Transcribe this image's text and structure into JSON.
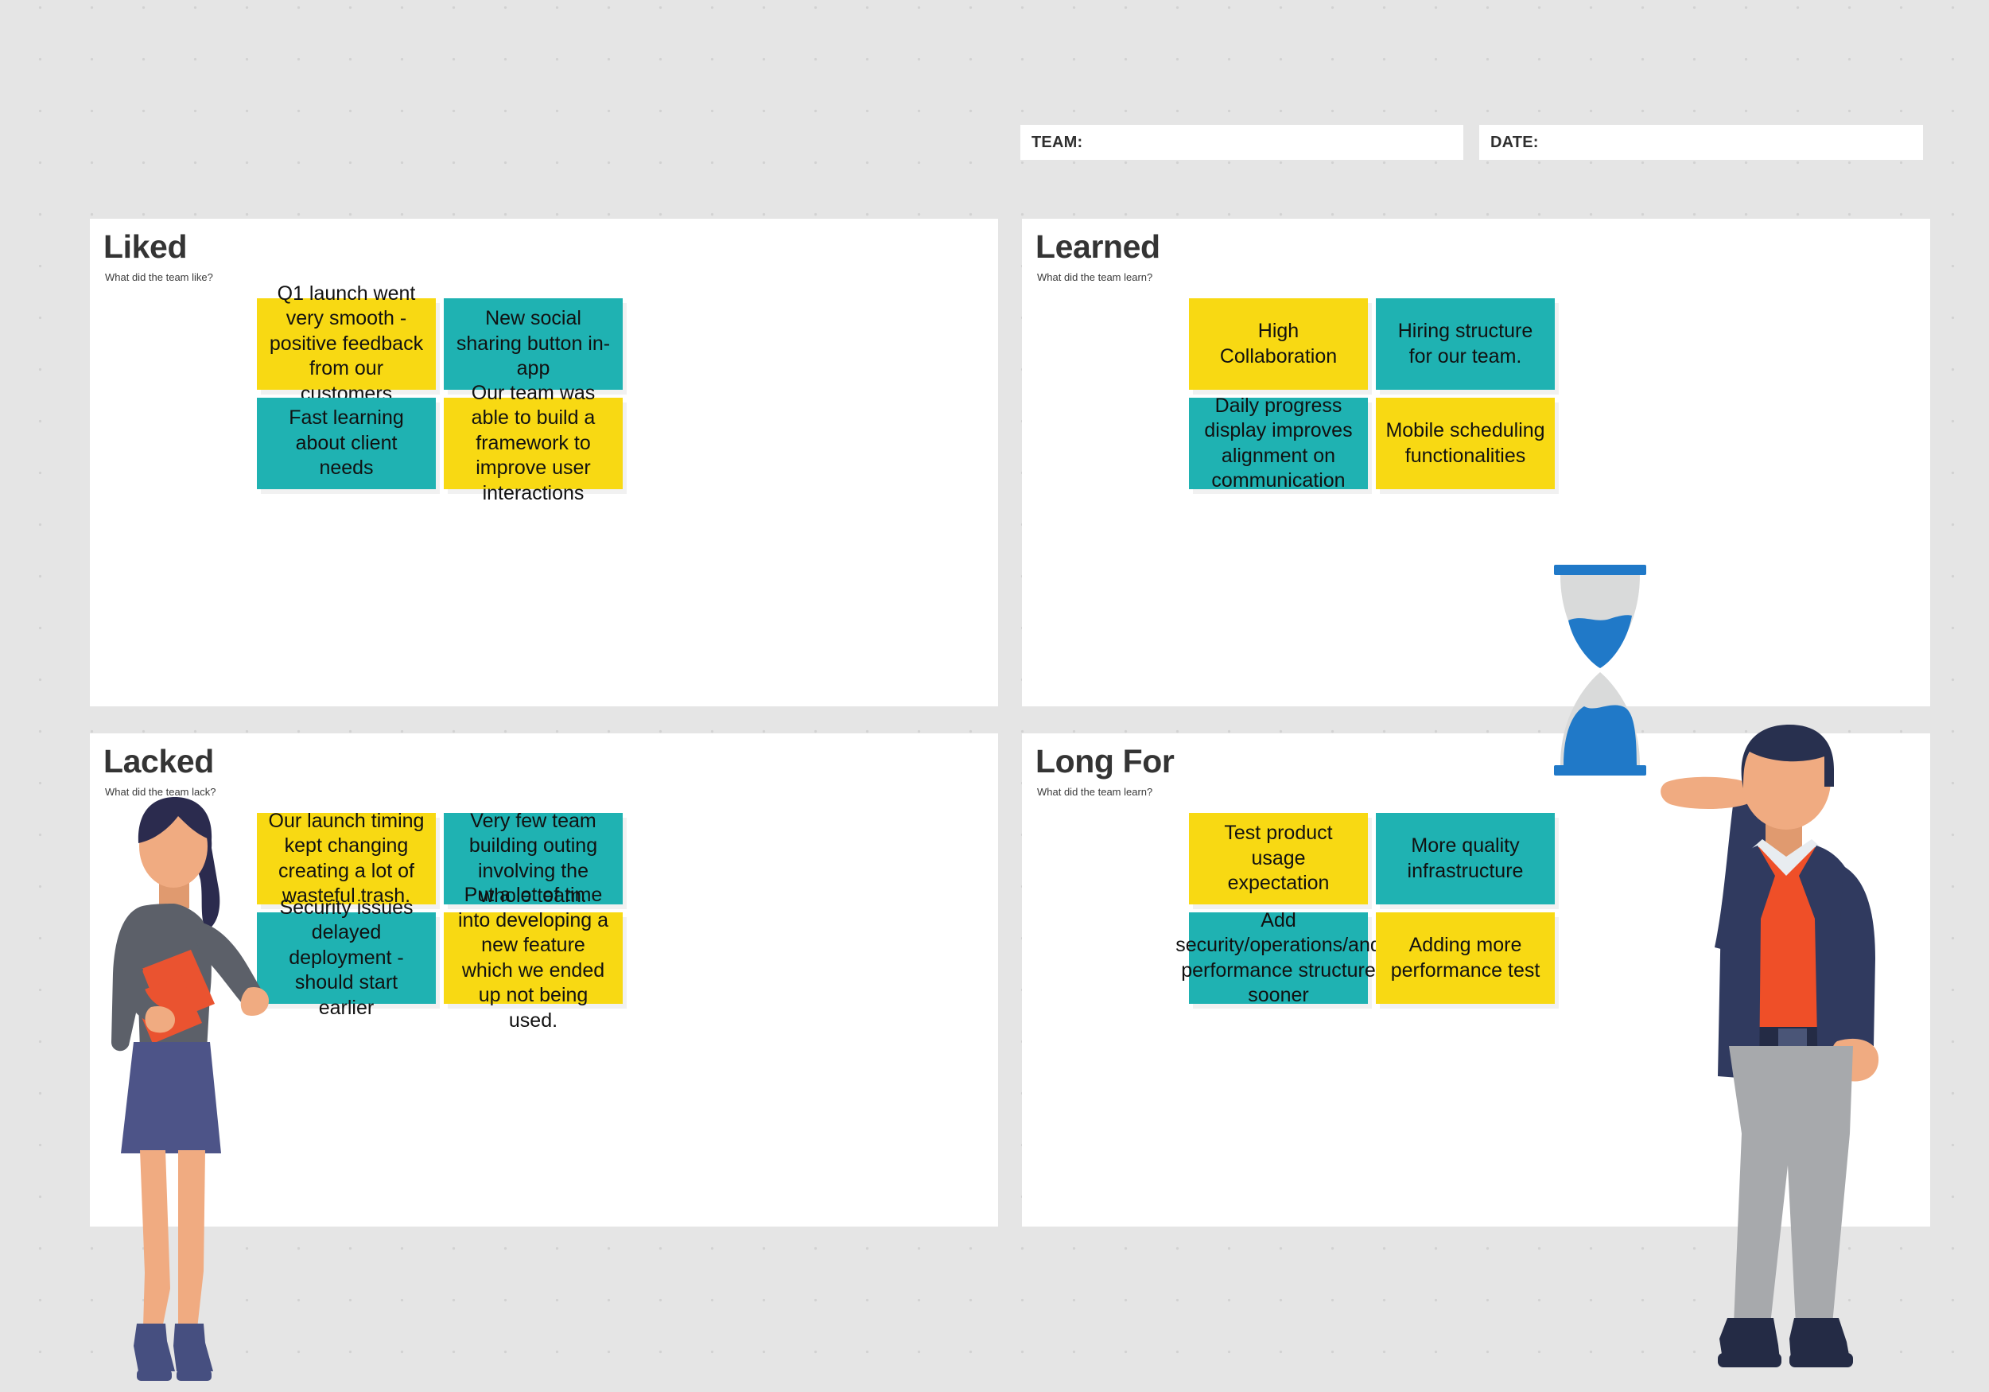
{
  "board": {
    "type": "retrospective-4l-board",
    "background_color": "#e5e5e5",
    "panel_color": "#ffffff",
    "note_yellow": "#f8d913",
    "note_teal": "#1fb2b2"
  },
  "header": {
    "team_label": "TEAM:",
    "team_value": "",
    "date_label": "DATE:",
    "date_value": ""
  },
  "quadrants": [
    {
      "id": "liked",
      "title": "Liked",
      "subtitle": "What did the team like?",
      "notes": [
        {
          "text": "Q1 launch went very smooth - positive feedback from our customers",
          "color": "yellow"
        },
        {
          "text": "New social sharing button in-app",
          "color": "teal"
        },
        {
          "text": "Fast learning about client needs",
          "color": "teal"
        },
        {
          "text": "Our team was able to build a framework to improve user interactions",
          "color": "yellow"
        }
      ]
    },
    {
      "id": "learned",
      "title": "Learned",
      "subtitle": "What did the team learn?",
      "notes": [
        {
          "text": "High Collaboration",
          "color": "yellow"
        },
        {
          "text": "Hiring structure for our team.",
          "color": "teal"
        },
        {
          "text": "Daily progress display improves alignment on communication",
          "color": "teal"
        },
        {
          "text": "Mobile scheduling functionalities",
          "color": "yellow"
        }
      ]
    },
    {
      "id": "lacked",
      "title": "Lacked",
      "subtitle": "What did the team lack?",
      "notes": [
        {
          "text": "Our launch timing kept changing creating a lot of wasteful trash.",
          "color": "yellow"
        },
        {
          "text": "Very few team building outing involving the whole team.",
          "color": "teal"
        },
        {
          "text": "Security issues delayed deployment - should start earlier",
          "color": "teal"
        },
        {
          "text": "Put a lot of time into developing a new feature which we ended up not being used.",
          "color": "yellow"
        }
      ]
    },
    {
      "id": "long-for",
      "title": "Long For",
      "subtitle": "What did the team learn?",
      "notes": [
        {
          "text": "Test product usage expectation",
          "color": "yellow"
        },
        {
          "text": "More quality infrastructure",
          "color": "teal"
        },
        {
          "text": "Add security/operations/and performance structure sooner",
          "color": "teal"
        },
        {
          "text": "Adding more performance test",
          "color": "yellow"
        }
      ]
    }
  ],
  "illustrations": [
    {
      "name": "woman-holding-folders",
      "colors": {
        "hair": "#2b2b4e",
        "top": "#5c6069",
        "skirt": "#4d5488",
        "skin": "#f0ab81",
        "folder": "#ea5330",
        "shoes": "#464f80"
      }
    },
    {
      "name": "man-holding-hourglass",
      "colors": {
        "hair": "#28304f",
        "blazer": "#303a5f",
        "sweater": "#ef4f28",
        "shirt": "#e8ecf0",
        "trousers": "#a7a9ac",
        "skin": "#f0ab81",
        "shoes": "#242b45"
      }
    },
    {
      "name": "hourglass",
      "colors": {
        "glass": "#d9dada",
        "sand": "#2079c8",
        "cap": "#2079c8"
      }
    }
  ]
}
